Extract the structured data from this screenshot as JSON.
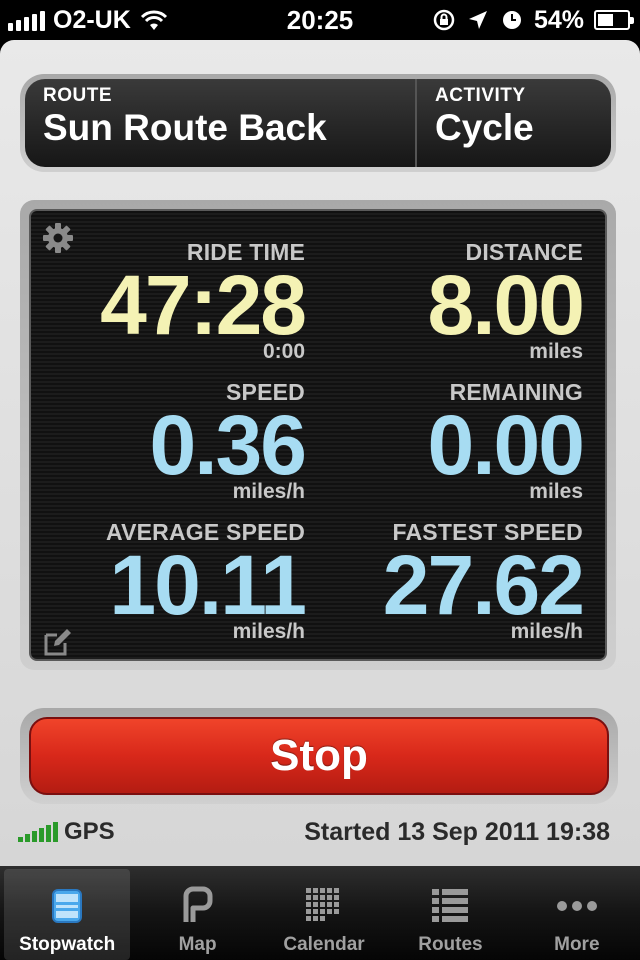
{
  "status_bar": {
    "carrier": "O2-UK",
    "time": "20:25",
    "battery_percent": "54%",
    "battery_level": 0.54,
    "icons": [
      "signal-icon",
      "wifi-icon",
      "rotation-lock-icon",
      "location-arrow-icon",
      "alarm-icon",
      "battery-icon"
    ]
  },
  "route": {
    "route_label": "ROUTE",
    "route_value": "Sun Route Back",
    "activity_label": "ACTIVITY",
    "activity_value": "Cycle"
  },
  "stats": {
    "ride_time": {
      "label": "RIDE TIME",
      "value": "47:28",
      "sub": "0:00"
    },
    "distance": {
      "label": "DISTANCE",
      "value": "8.00",
      "unit": "miles"
    },
    "speed": {
      "label": "SPEED",
      "value": "0.36",
      "unit": "miles/h"
    },
    "remaining": {
      "label": "REMAINING",
      "value": "0.00",
      "unit": "miles"
    },
    "average_speed": {
      "label": "AVERAGE SPEED",
      "value": "10.11",
      "unit": "miles/h"
    },
    "fastest_speed": {
      "label": "FASTEST SPEED",
      "value": "27.62",
      "unit": "miles/h"
    }
  },
  "colors": {
    "time_distance": "#f4f2b4",
    "speed_values": "#a7dcf2",
    "stop_button": "#d8281a",
    "gps_signal": "#2a9a2a"
  },
  "stop_label": "Stop",
  "footer": {
    "gps_label": "GPS",
    "started": "Started 13 Sep 2011 19:38"
  },
  "tabs": [
    {
      "label": "Stopwatch",
      "icon": "stopwatch-icon",
      "active": true
    },
    {
      "label": "Map",
      "icon": "map-icon",
      "active": false
    },
    {
      "label": "Calendar",
      "icon": "calendar-icon",
      "active": false
    },
    {
      "label": "Routes",
      "icon": "routes-list-icon",
      "active": false
    },
    {
      "label": "More",
      "icon": "more-dots-icon",
      "active": false
    }
  ]
}
